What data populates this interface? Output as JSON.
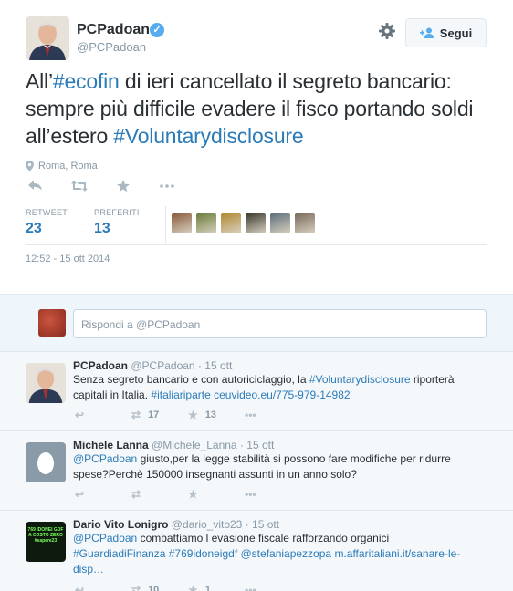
{
  "main_tweet": {
    "name": "PCPadoan",
    "handle": "@PCPadoan",
    "follow_label": "Segui",
    "text_parts": [
      "All’",
      "#ecofin",
      " di ieri cancellato il segreto bancario: sempre più difficile evadere il fisco portando soldi all’estero ",
      "#Voluntarydisclosure"
    ],
    "location": "Roma, Roma",
    "retweet_label": "RETWEET",
    "retweet_count": "23",
    "favorites_label": "PREFERITI",
    "favorites_count": "13",
    "timestamp": "12:52 - 15 ott 2014",
    "favoriter_avatar_colors": [
      "#8a5a3c",
      "#6b7d3a",
      "#b08a30",
      "#3a3a30",
      "#5e6e7a",
      "#7a6a5c"
    ]
  },
  "reply_box": {
    "placeholder": "Rispondi a @PCPadoan"
  },
  "replies": [
    {
      "name": "PCPadoan",
      "handle": "@PCPadoan",
      "time": "15 ott",
      "text_parts": [
        "Senza segreto bancario e con autoriciclaggio, la ",
        "#Voluntarydisclosure",
        " riporterà capitali in Italia. ",
        "#italiariparte",
        " ",
        "ceuvideo.eu/775-979-14982"
      ],
      "retweets": "17",
      "favorites": "13"
    },
    {
      "name": "Michele Lanna",
      "handle": "@Michele_Lanna",
      "time": "15 ott",
      "text_parts": [
        "@PCPadoan",
        " giusto,per la legge stabilità si possono fare modifiche per ridurre spese?Perchè 150000 insegnanti assunti in un anno solo?"
      ],
      "retweets": "",
      "favorites": ""
    },
    {
      "name": "Dario Vito Lonigro",
      "handle": "@dario_vito23",
      "time": "15 ott",
      "text_parts": [
        "@PCPadoan",
        " combattiamo l evasione fiscale rafforzando organici ",
        "#GuardiadiFinanza",
        " ",
        "#769idoneigdf",
        " ",
        "@stefaniapezzopa",
        " ",
        "m.affaritaliani.it/sanare-le-disp…"
      ],
      "avatar_text": [
        "769 IDONEI GDF",
        "A COSTO ZERO",
        "#sapere23"
      ],
      "retweets": "10",
      "favorites": "1"
    }
  ],
  "time_sep": " · ",
  "icons": {
    "verified": "verified-badge-icon",
    "gear": "gear-icon",
    "follow": "person-add-icon",
    "location": "map-pin-icon",
    "reply": "reply-icon",
    "retweet": "retweet-icon",
    "favorite": "star-icon",
    "more": "more-icon"
  }
}
